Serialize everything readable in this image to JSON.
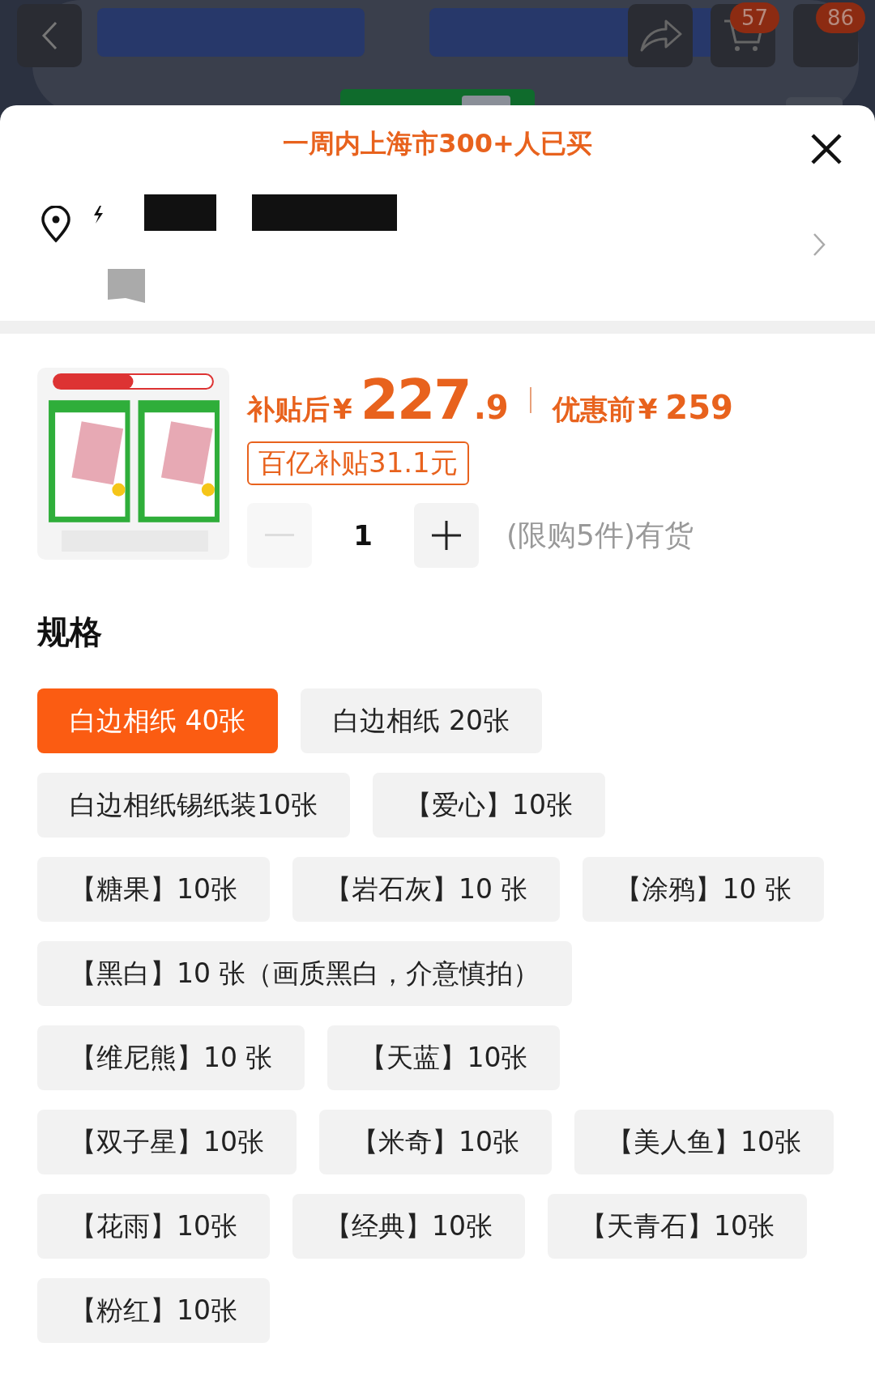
{
  "backdrop": {
    "badges": [
      "57",
      "86"
    ]
  },
  "sheet": {
    "title": "一周内上海市300+人已买"
  },
  "product": {
    "price_label": "补贴后",
    "currency": "¥",
    "price_int": "227",
    "price_dec": ".9",
    "original_label": "优惠前",
    "original_currency": "¥",
    "original_price": "259",
    "subsidy": "百亿补贴31.1元",
    "quantity": "1",
    "minus_disabled": true,
    "stock": "(限购5件)有货"
  },
  "spec": {
    "heading": "规格",
    "options": [
      {
        "label": "白边相纸 40张",
        "selected": true
      },
      {
        "label": "白边相纸 20张",
        "selected": false
      },
      {
        "label": "白边相纸锡纸装10张",
        "selected": false
      },
      {
        "label": "【爱心】10张",
        "selected": false
      },
      {
        "label": "【糖果】10张",
        "selected": false
      },
      {
        "label": "【岩石灰】10 张",
        "selected": false
      },
      {
        "label": "【涂鸦】10 张",
        "selected": false
      },
      {
        "label": "【黑白】10 张（画质黑白，介意慎拍）",
        "selected": false
      },
      {
        "label": "【维尼熊】10 张",
        "selected": false
      },
      {
        "label": "【天蓝】10张",
        "selected": false
      },
      {
        "label": "【双子星】10张",
        "selected": false
      },
      {
        "label": "【米奇】10张",
        "selected": false
      },
      {
        "label": "【美人鱼】10张",
        "selected": false
      },
      {
        "label": "【花雨】10张",
        "selected": false
      },
      {
        "label": "【经典】10张",
        "selected": false
      },
      {
        "label": "【天青石】10张",
        "selected": false
      },
      {
        "label": "【粉红】10张",
        "selected": false
      }
    ]
  }
}
